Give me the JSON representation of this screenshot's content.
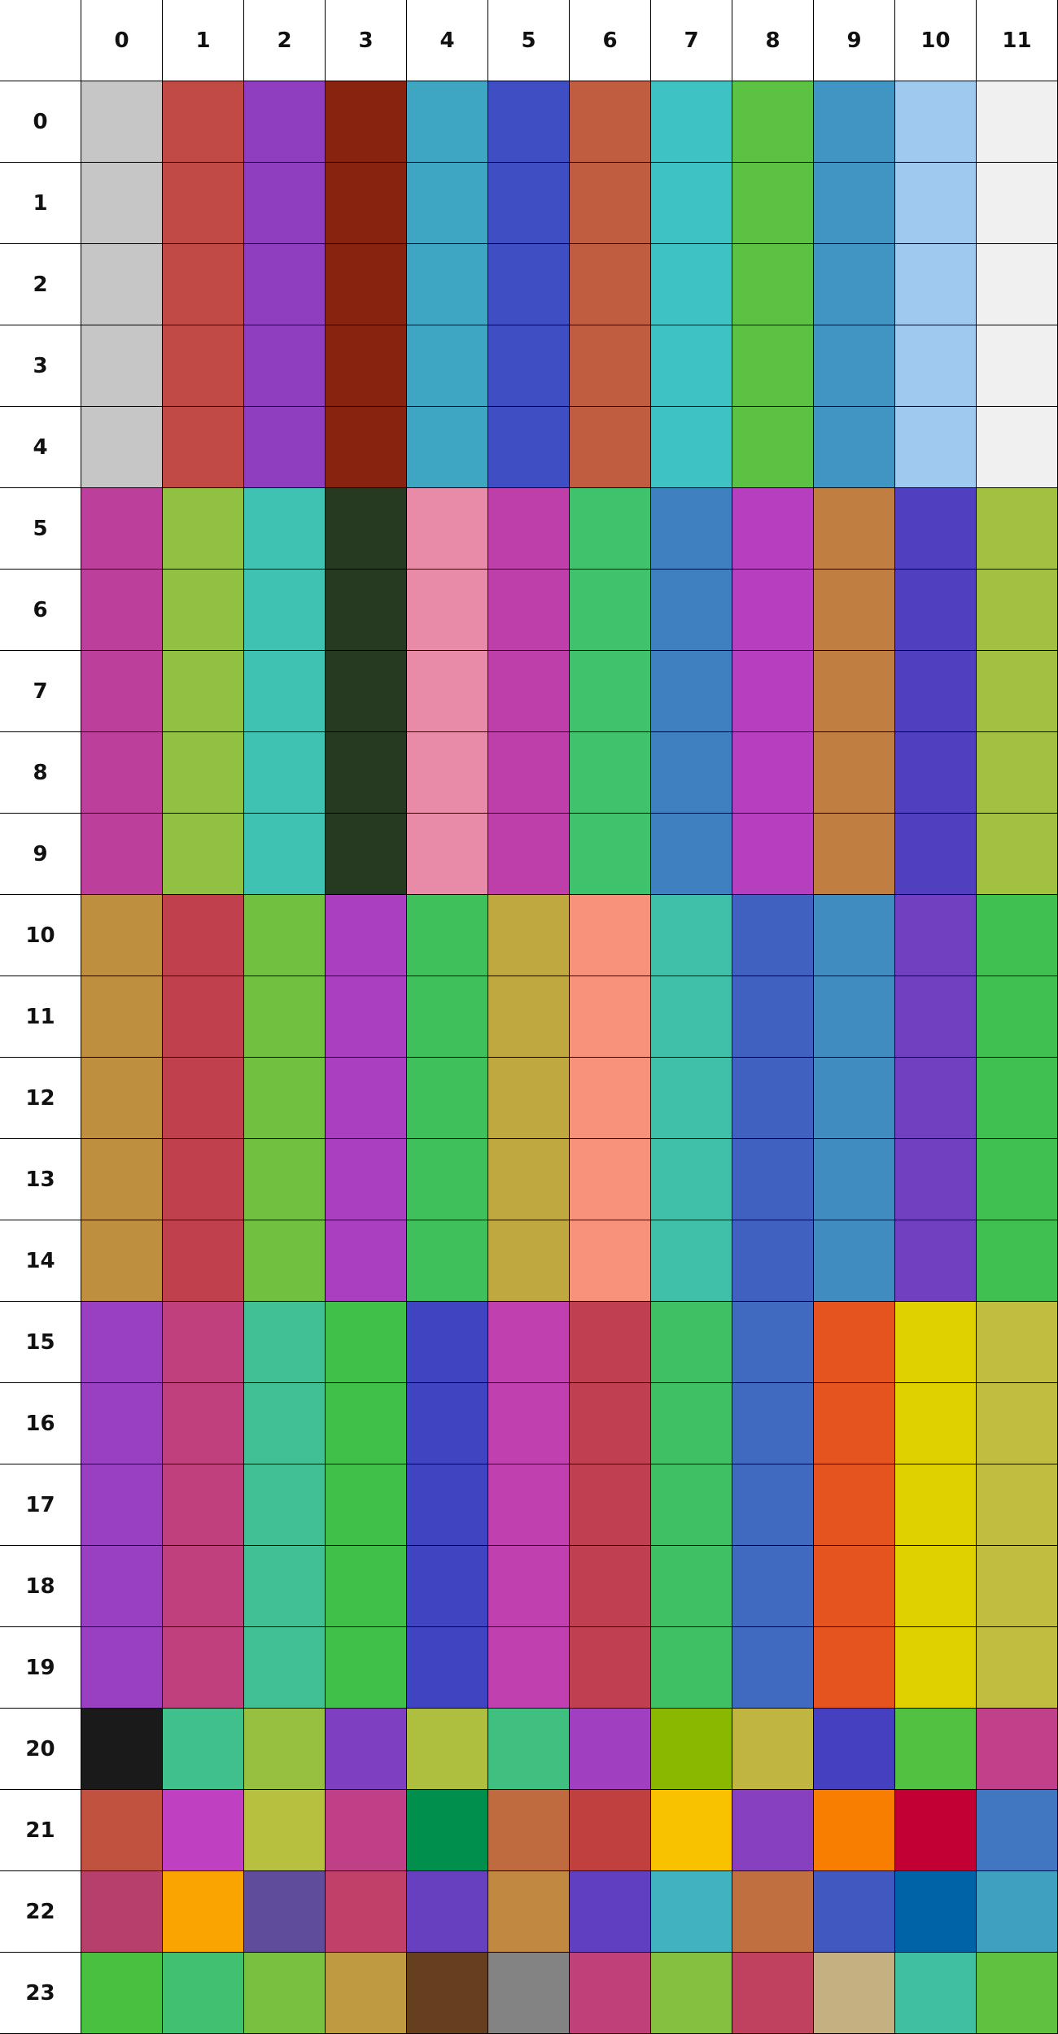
{
  "grid": {
    "col_labels": [
      "0",
      "1",
      "2",
      "3",
      "4",
      "5",
      "6",
      "7",
      "8",
      "9",
      "10",
      "11"
    ],
    "row_labels": [
      "0",
      "1",
      "2",
      "3",
      "4",
      "5",
      "6",
      "7",
      "8",
      "9",
      "10",
      "11",
      "12",
      "13",
      "14",
      "15",
      "16",
      "17",
      "18",
      "19",
      "20",
      "21",
      "22",
      "23"
    ],
    "colors": [
      [
        "#c6c6c6",
        "#c24a44",
        "#8f3ec0",
        "#87230f",
        "#3fa6c2",
        "#3f4ec2",
        "#c05c3f",
        "#3fc2c2",
        "#5cc244",
        "#4095c2",
        "#a0c9f0",
        "#f0f0f0"
      ],
      [
        "#c6c6c6",
        "#c24a44",
        "#8f3ec0",
        "#87230f",
        "#3fa6c2",
        "#3f4ec2",
        "#c05c3f",
        "#3fc2c2",
        "#5cc244",
        "#4095c2",
        "#a0c9f0",
        "#f0f0f0"
      ],
      [
        "#c6c6c6",
        "#c24a44",
        "#8f3ec0",
        "#87230f",
        "#3fa6c2",
        "#3f4ec2",
        "#c05c3f",
        "#3fc2c2",
        "#5cc244",
        "#4095c2",
        "#a0c9f0",
        "#f0f0f0"
      ],
      [
        "#c6c6c6",
        "#c24a44",
        "#8f3ec0",
        "#87230f",
        "#3fa6c2",
        "#3f4ec2",
        "#c05c3f",
        "#3fc2c2",
        "#5cc244",
        "#4095c2",
        "#a0c9f0",
        "#f0f0f0"
      ],
      [
        "#c6c6c6",
        "#c24a44",
        "#8f3ec0",
        "#87230f",
        "#3fa6c2",
        "#3f4ec2",
        "#c05c3f",
        "#3fc2c2",
        "#5cc244",
        "#4095c2",
        "#a0c9f0",
        "#f0f0f0"
      ],
      [
        "#bc3f9c",
        "#91c142",
        "#40c2b2",
        "#263a22",
        "#e78ba9",
        "#be3fa9",
        "#3fc26c",
        "#3f80c0",
        "#b63fc0",
        "#c07f40",
        "#5040c0",
        "#a3c140"
      ],
      [
        "#bc3f9c",
        "#91c142",
        "#40c2b2",
        "#263a22",
        "#e78ba9",
        "#be3fa9",
        "#3fc26c",
        "#3f80c0",
        "#b63fc0",
        "#c07f40",
        "#5040c0",
        "#a3c140"
      ],
      [
        "#bc3f9c",
        "#91c142",
        "#40c2b2",
        "#263a22",
        "#e78ba9",
        "#be3fa9",
        "#3fc26c",
        "#3f80c0",
        "#b63fc0",
        "#c07f40",
        "#5040c0",
        "#a3c140"
      ],
      [
        "#bc3f9c",
        "#91c142",
        "#40c2b2",
        "#263a22",
        "#e78ba9",
        "#be3fa9",
        "#3fc26c",
        "#3f80c0",
        "#b63fc0",
        "#c07f40",
        "#5040c0",
        "#a3c140"
      ],
      [
        "#bc3f9c",
        "#91c142",
        "#40c2b2",
        "#263a22",
        "#e78ba9",
        "#be3fa9",
        "#3fc26c",
        "#3f80c0",
        "#b63fc0",
        "#c07f40",
        "#5040c0",
        "#a3c140"
      ],
      [
        "#bf8f40",
        "#c0404e",
        "#71c040",
        "#aa40c0",
        "#40c05a",
        "#c0a840",
        "#f9927a",
        "#40c0a8",
        "#4061c0",
        "#408bc0",
        "#7140c0",
        "#40c050"
      ],
      [
        "#bf8f40",
        "#c0404e",
        "#71c040",
        "#aa40c0",
        "#40c05a",
        "#c0a840",
        "#f9927a",
        "#40c0a8",
        "#4061c0",
        "#408bc0",
        "#7140c0",
        "#40c050"
      ],
      [
        "#bf8f40",
        "#c0404e",
        "#71c040",
        "#aa40c0",
        "#40c05a",
        "#c0a840",
        "#f9927a",
        "#40c0a8",
        "#4061c0",
        "#408bc0",
        "#7140c0",
        "#40c050"
      ],
      [
        "#bf8f40",
        "#c0404e",
        "#71c040",
        "#aa40c0",
        "#40c05a",
        "#c0a840",
        "#f9927a",
        "#40c0a8",
        "#4061c0",
        "#408bc0",
        "#7140c0",
        "#40c050"
      ],
      [
        "#bf8f40",
        "#c0404e",
        "#71c040",
        "#aa40c0",
        "#40c05a",
        "#c0a840",
        "#f9927a",
        "#40c0a8",
        "#4061c0",
        "#408bc0",
        "#7140c0",
        "#40c050"
      ],
      [
        "#9840c0",
        "#c0407e",
        "#40c094",
        "#40c048",
        "#4044c0",
        "#c040b0",
        "#c0404f",
        "#40c064",
        "#4069c0",
        "#e5531f",
        "#dfd100",
        "#c0bd40"
      ],
      [
        "#9840c0",
        "#c0407e",
        "#40c094",
        "#40c048",
        "#4044c0",
        "#c040b0",
        "#c0404f",
        "#40c064",
        "#4069c0",
        "#e5531f",
        "#dfd100",
        "#c0bd40"
      ],
      [
        "#9840c0",
        "#c0407e",
        "#40c094",
        "#40c048",
        "#4044c0",
        "#c040b0",
        "#c0404f",
        "#40c064",
        "#4069c0",
        "#e5531f",
        "#dfd100",
        "#c0bd40"
      ],
      [
        "#9840c0",
        "#c0407e",
        "#40c094",
        "#40c048",
        "#4044c0",
        "#c040b0",
        "#c0404f",
        "#40c064",
        "#4069c0",
        "#e5531f",
        "#dfd100",
        "#c0bd40"
      ],
      [
        "#9840c0",
        "#c0407e",
        "#40c094",
        "#40c048",
        "#4044c0",
        "#c040b0",
        "#c0404f",
        "#40c064",
        "#4069c0",
        "#e5531f",
        "#dfd100",
        "#c0bd40"
      ],
      [
        "#1a1a1a",
        "#40c08a",
        "#98c040",
        "#7e40c0",
        "#aebf40",
        "#40c080",
        "#a040c0",
        "#8ab800",
        "#c0b540",
        "#4440c0",
        "#52c040",
        "#c0408a"
      ],
      [
        "#c0523f",
        "#bf40c0",
        "#b8c040",
        "#c04088",
        "#008f4d",
        "#c06a40",
        "#c04040",
        "#f8c200",
        "#8640c0",
        "#f77e00",
        "#c20033",
        "#4077c0"
      ],
      [
        "#b63f6c",
        "#f9a400",
        "#5f4c9a",
        "#c0406a",
        "#6740c0",
        "#c08840",
        "#6040c0",
        "#40b2c0",
        "#c07040",
        "#4058c0",
        "#0063a8",
        "#40a0c0"
      ],
      [
        "#48c040",
        "#40c070",
        "#7ac040",
        "#c09a40",
        "#66401e",
        "#838383",
        "#c0407a",
        "#86c040",
        "#c04060",
        "#c4b080",
        "#40c0a0",
        "#60c040"
      ]
    ]
  }
}
